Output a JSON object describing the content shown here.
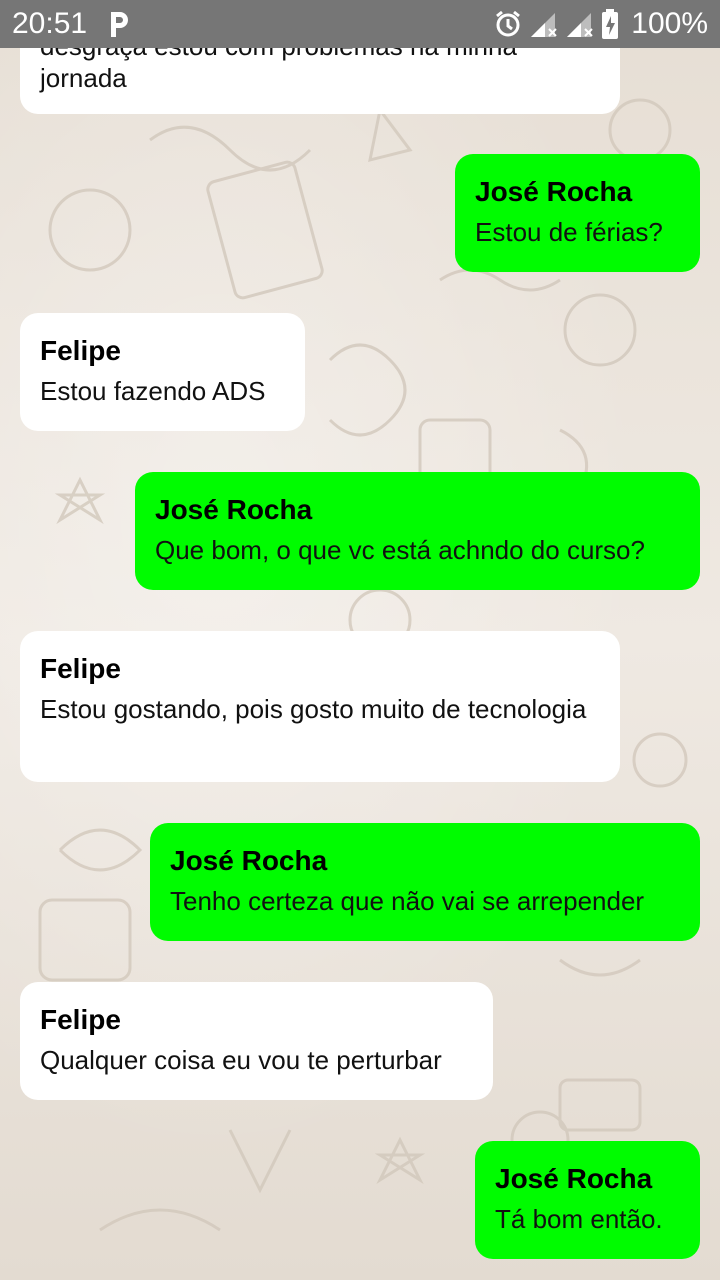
{
  "status_bar": {
    "time": "20:51",
    "battery": "100%",
    "icons": [
      "parking-app-icon",
      "alarm-icon",
      "signal-icon",
      "signal-icon",
      "battery-icon"
    ]
  },
  "colors": {
    "outgoing": "#00fc00",
    "incoming": "#ffffff",
    "status_bar": "#767676"
  },
  "messages": [
    {
      "direction": "incoming",
      "sender": "",
      "text": "desgraça estou com problemas na minha jornada"
    },
    {
      "direction": "outgoing",
      "sender": "José Rocha",
      "text": "Estou de férias?"
    },
    {
      "direction": "incoming",
      "sender": "Felipe",
      "text": "Estou fazendo ADS"
    },
    {
      "direction": "outgoing",
      "sender": "José Rocha",
      "text": "Que bom, o que vc está achndo do curso?"
    },
    {
      "direction": "incoming",
      "sender": "Felipe",
      "text": "Estou gostando, pois gosto muito de tecnologia"
    },
    {
      "direction": "outgoing",
      "sender": "José Rocha",
      "text": "Tenho certeza que não vai se arrepender"
    },
    {
      "direction": "incoming",
      "sender": "Felipe",
      "text": "Qualquer coisa eu vou te perturbar"
    },
    {
      "direction": "outgoing",
      "sender": "José Rocha",
      "text": "Tá bom então."
    }
  ]
}
